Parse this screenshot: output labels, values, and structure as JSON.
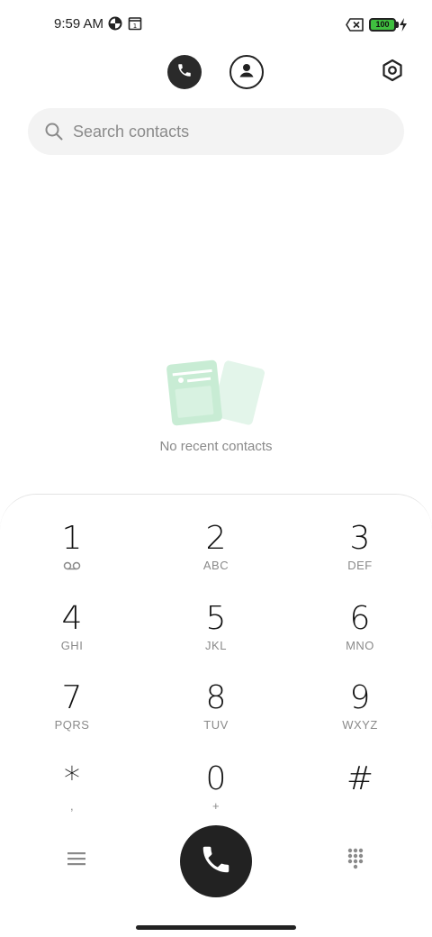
{
  "status_bar": {
    "time": "9:59 AM",
    "icons": [
      "data-saver-icon",
      "calendar-icon",
      "no-sim-icon",
      "battery-icon",
      "charging-icon"
    ],
    "calendar_day": "1",
    "battery_level": "100",
    "battery_color": "#3fbf3f"
  },
  "top_bar": {
    "tabs": [
      {
        "name": "recents",
        "icon": "phone-icon",
        "active": true
      },
      {
        "name": "contacts",
        "icon": "person-icon",
        "active": false
      }
    ],
    "settings_icon": "settings-icon"
  },
  "search": {
    "placeholder": "Search contacts",
    "value": ""
  },
  "empty_state": {
    "text": "No recent contacts",
    "illustration_color": "#c8ecd4"
  },
  "dialpad": {
    "keys": [
      {
        "digit": "1",
        "letters": "",
        "sub_icon": "voicemail-icon"
      },
      {
        "digit": "2",
        "letters": "ABC"
      },
      {
        "digit": "3",
        "letters": "DEF"
      },
      {
        "digit": "4",
        "letters": "GHI"
      },
      {
        "digit": "5",
        "letters": "JKL"
      },
      {
        "digit": "6",
        "letters": "MNO"
      },
      {
        "digit": "7",
        "letters": "PQRS"
      },
      {
        "digit": "8",
        "letters": "TUV"
      },
      {
        "digit": "9",
        "letters": "WXYZ"
      },
      {
        "digit": "*",
        "letters": ","
      },
      {
        "digit": "0",
        "letters": "+"
      },
      {
        "digit": "#",
        "letters": ""
      }
    ],
    "menu_icon": "menu-icon",
    "call_icon": "phone-icon",
    "toggle_icon": "dialpad-icon",
    "call_button_color": "#222222"
  }
}
